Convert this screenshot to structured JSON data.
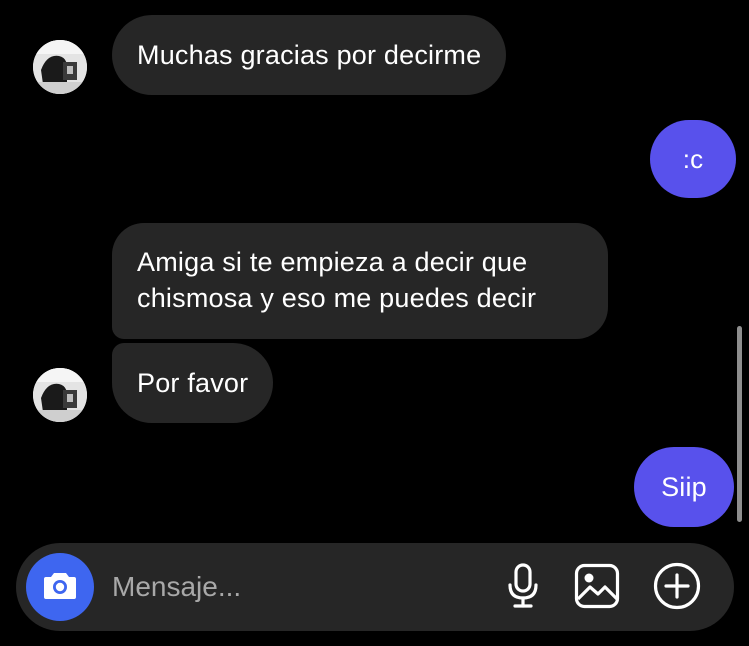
{
  "messages": [
    {
      "id": "msg1",
      "direction": "incoming",
      "text": "Muchas gracias por decirme"
    },
    {
      "id": "msg2",
      "direction": "outgoing",
      "text": ":c"
    },
    {
      "id": "msg3",
      "direction": "incoming",
      "text": "Amiga si te empieza a decir que chismosa y eso me puedes decir"
    },
    {
      "id": "msg4",
      "direction": "incoming",
      "text": "Por favor"
    },
    {
      "id": "msg5",
      "direction": "outgoing",
      "text": "Siip"
    }
  ],
  "composer": {
    "placeholder": "Mensaje...",
    "camera_icon": "camera-icon",
    "mic_icon": "microphone-icon",
    "gallery_icon": "image-icon",
    "plus_icon": "plus-circle-icon"
  },
  "colors": {
    "background": "#000000",
    "incoming_bubble": "#262626",
    "outgoing_bubble": "#5851ec",
    "camera_button": "#3e66f0",
    "composer": "#262626"
  }
}
